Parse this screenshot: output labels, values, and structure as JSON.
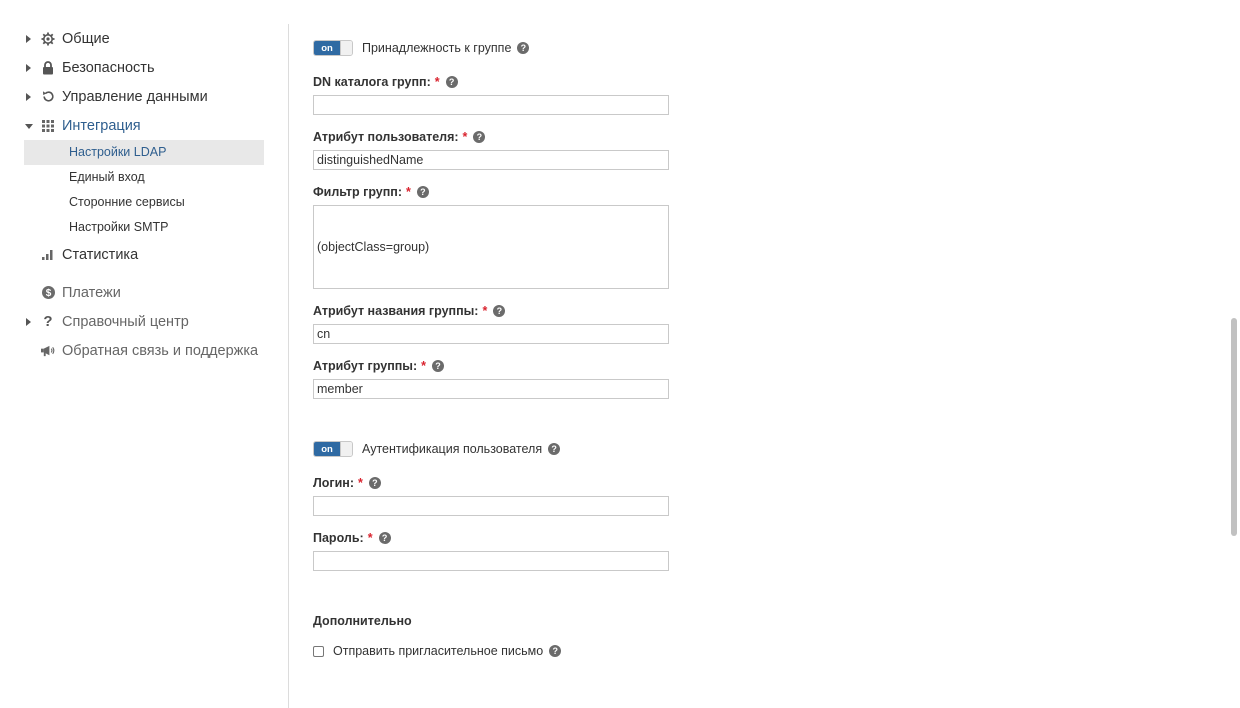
{
  "sidebar": {
    "items": [
      {
        "label": "Общие",
        "icon": "gear-icon",
        "arrow": "right"
      },
      {
        "label": "Безопасность",
        "icon": "lock-icon",
        "arrow": "right"
      },
      {
        "label": "Управление данными",
        "icon": "refresh-icon",
        "arrow": "right"
      },
      {
        "label": "Интеграция",
        "icon": "grid-icon",
        "arrow": "down"
      }
    ],
    "subitems": [
      {
        "label": "Настройки LDAP",
        "selected": true
      },
      {
        "label": "Единый вход"
      },
      {
        "label": "Сторонние сервисы"
      },
      {
        "label": "Настройки SMTP"
      }
    ],
    "items2": [
      {
        "label": "Статистика",
        "icon": "bar-chart-icon"
      },
      {
        "label": "Платежи",
        "icon": "dollar-icon"
      },
      {
        "label": "Справочный центр",
        "icon": "question-icon",
        "arrow": "right"
      },
      {
        "label": "Обратная связь и поддержка",
        "icon": "megaphone-icon"
      }
    ]
  },
  "form": {
    "toggle_on_label": "on",
    "group_membership": {
      "label": "Принадлежность к группе",
      "state": "on"
    },
    "group_dn": {
      "label": "DN каталога групп:",
      "value": ""
    },
    "user_attribute": {
      "label": "Атрибут пользователя:",
      "value": "distinguishedName"
    },
    "group_filter": {
      "label": "Фильтр групп:",
      "value": "(objectClass=group)"
    },
    "group_name_attribute": {
      "label": "Атрибут названия группы:",
      "value": "cn"
    },
    "group_attribute": {
      "label": "Атрибут группы:",
      "value": "member"
    },
    "user_auth": {
      "label": "Аутентификация пользователя",
      "state": "on"
    },
    "login": {
      "label": "Логин:",
      "value": ""
    },
    "password": {
      "label": "Пароль:",
      "value": ""
    },
    "additional": {
      "title": "Дополнительно",
      "send_invite_label": "Отправить пригласительное письмо",
      "send_invite_checked": false
    },
    "required_mark": "*",
    "help_glyph": "?"
  },
  "colors": {
    "accent": "#2f6aa3",
    "active_text": "#2e5e8e",
    "required": "#d9232e"
  }
}
